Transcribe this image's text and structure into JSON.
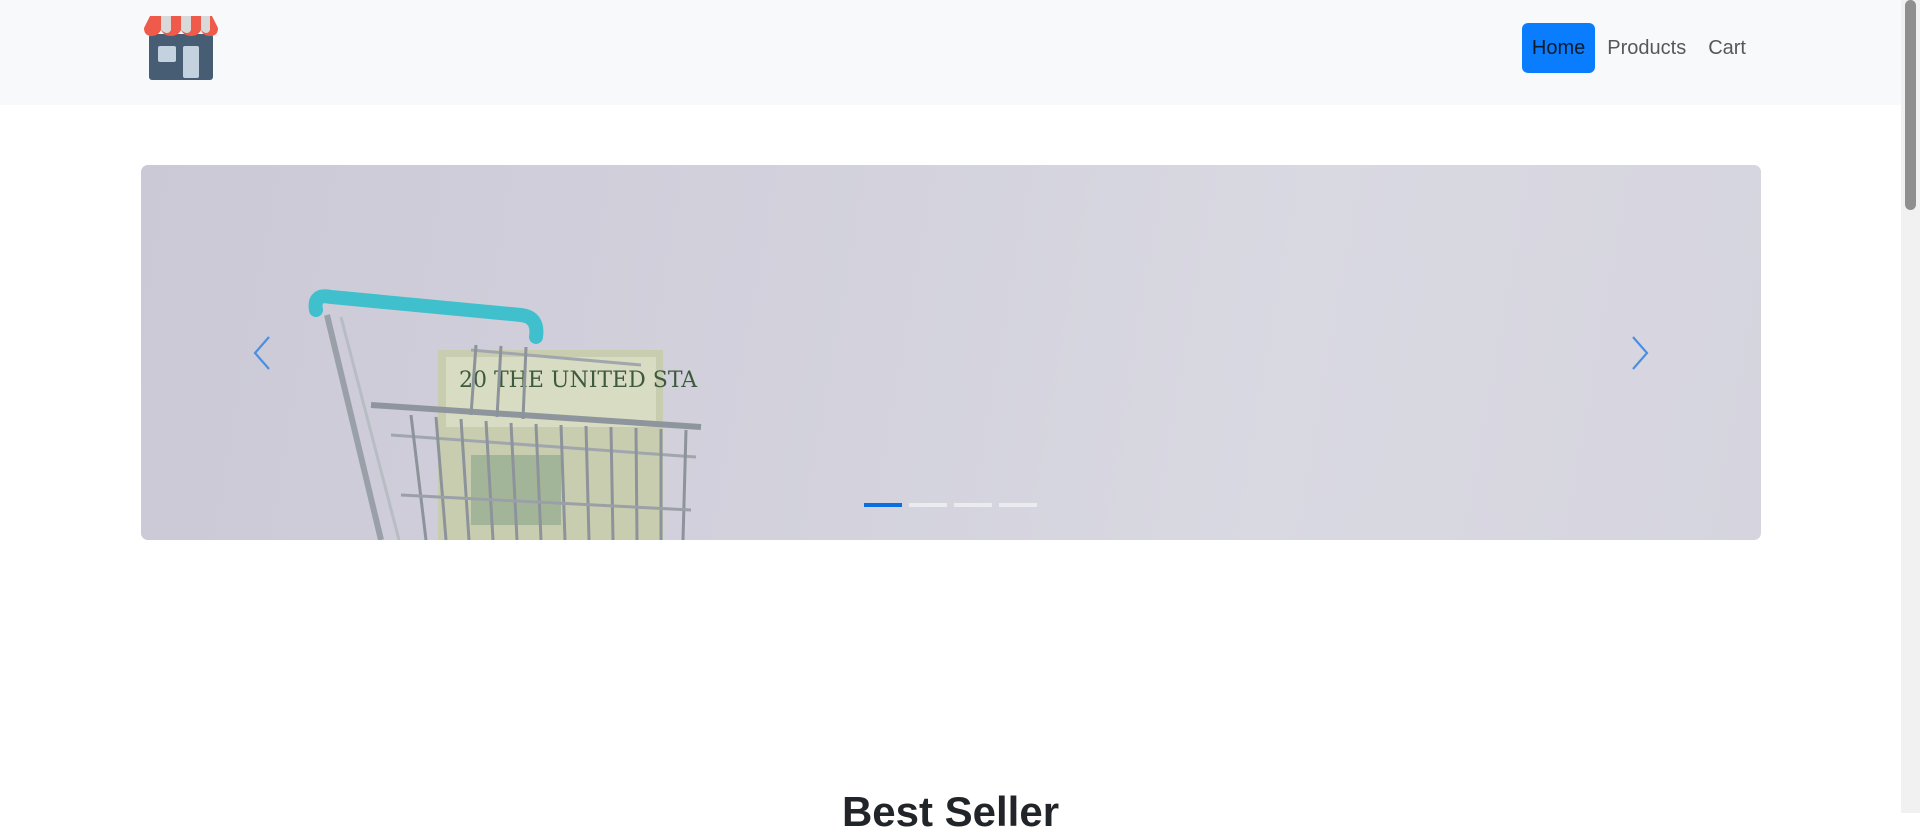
{
  "header": {
    "logo_icon": "storefront-icon",
    "nav": [
      {
        "label": "Home",
        "active": true
      },
      {
        "label": "Products",
        "active": false
      },
      {
        "label": "Cart",
        "active": false
      }
    ]
  },
  "carousel": {
    "image": "shopping-cart-with-money-photo",
    "prev_icon": "chevron-left-icon",
    "next_icon": "chevron-right-icon",
    "slide_count": 4,
    "active_slide": 1
  },
  "best_seller": {
    "title": "Best Seller"
  },
  "colors": {
    "navbar_bg": "#f8f9fa",
    "accent": "#0a7dff",
    "carousel_bg": "#d2d1dc"
  }
}
